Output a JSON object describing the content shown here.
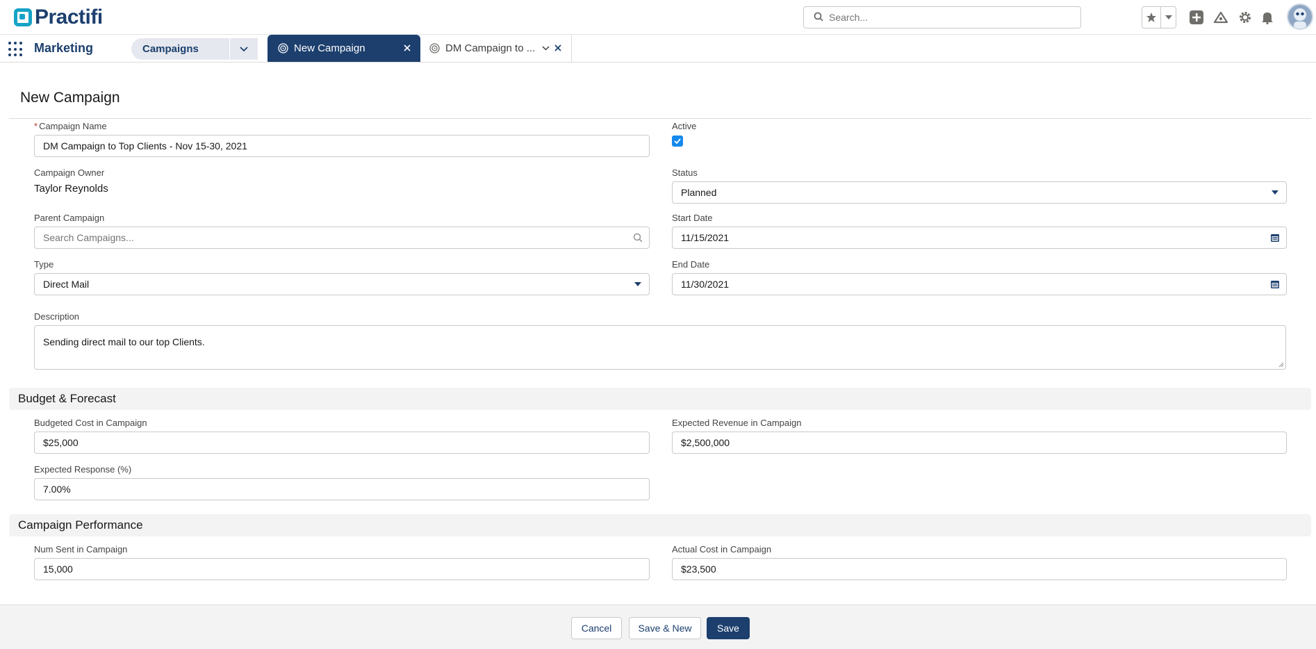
{
  "brand": {
    "name": "Practifi"
  },
  "header": {
    "search_placeholder": "Search...",
    "icons": [
      "star-icon",
      "chevron-down-icon",
      "add-icon",
      "trailhead-icon",
      "setup-gear-icon",
      "notification-bell-icon",
      "avatar"
    ]
  },
  "nav": {
    "app_name": "Marketing",
    "object_tab": "Campaigns",
    "tabs": [
      {
        "label": "New Campaign",
        "active": true
      },
      {
        "label": "DM Campaign to ...",
        "active": false
      }
    ]
  },
  "form": {
    "title": "New Campaign",
    "campaign_name": {
      "label": "Campaign Name",
      "required_marker": "*",
      "value": "DM Campaign to Top Clients - Nov 15-30, 2021"
    },
    "active": {
      "label": "Active",
      "checked": true
    },
    "campaign_owner": {
      "label": "Campaign Owner",
      "value": "Taylor Reynolds"
    },
    "status": {
      "label": "Status",
      "value": "Planned"
    },
    "parent_campaign": {
      "label": "Parent Campaign",
      "placeholder": "Search Campaigns..."
    },
    "start_date": {
      "label": "Start Date",
      "value": "11/15/2021"
    },
    "type": {
      "label": "Type",
      "value": "Direct Mail"
    },
    "end_date": {
      "label": "End Date",
      "value": "11/30/2021"
    },
    "description": {
      "label": "Description",
      "value": "Sending direct mail to our top Clients."
    }
  },
  "budget_section": {
    "title": "Budget & Forecast",
    "budgeted_cost": {
      "label": "Budgeted Cost in Campaign",
      "value": "$25,000"
    },
    "expected_revenue": {
      "label": "Expected Revenue in Campaign",
      "value": "$2,500,000"
    },
    "expected_response": {
      "label": "Expected Response (%)",
      "value": "7.00%"
    }
  },
  "performance_section": {
    "title": "Campaign Performance",
    "num_sent": {
      "label": "Num Sent in Campaign",
      "value": "15,000"
    },
    "actual_cost": {
      "label": "Actual Cost in Campaign",
      "value": "$23,500"
    }
  },
  "footer": {
    "cancel": "Cancel",
    "save_new": "Save & New",
    "save": "Save"
  },
  "colors": {
    "brand_navy": "#1c3f6e",
    "brand_teal": "#15a3c7",
    "checkbox_blue": "#1589ee"
  }
}
